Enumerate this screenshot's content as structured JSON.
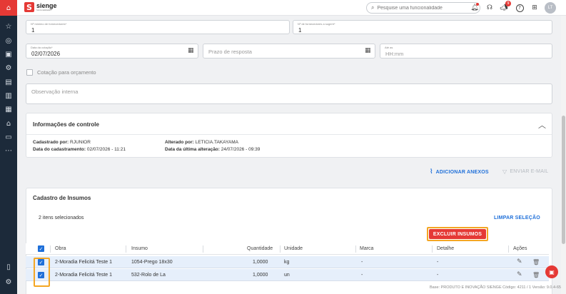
{
  "header": {
    "brand_name": "sienge",
    "brand_sub": "funcionalidades",
    "search_placeholder": "Pesquise uma funcionalidade",
    "notifications_count": "9",
    "avatar_initials": "LT"
  },
  "form": {
    "min_suppliers_label": "Nº mínimo de fornecedores*",
    "min_suppliers_value": "1",
    "suggested_suppliers_label": "Nº de fornecedores a sugerir*",
    "suggested_suppliers_value": "1",
    "quote_date_label": "Data da cotação*",
    "quote_date_value": "02/07/2026",
    "response_deadline_placeholder": "Prazo de resposta",
    "until_label": "Até as",
    "until_placeholder": "HH:mm",
    "budget_quote_label": "Cotação para orçamento",
    "internal_note_placeholder": "Observação interna"
  },
  "control_info": {
    "title": "Informações de controle",
    "registered_by_label": "Cadastrado por:",
    "registered_by_value": "RJUNIOR",
    "registered_date_label": "Data do cadastramento:",
    "registered_date_value": "02/07/2026 - 11:21",
    "changed_by_label": "Alterado por:",
    "changed_by_value": "LETICIA.TAKAYAMA",
    "changed_date_label": "Data da última alteração:",
    "changed_date_value": "24/07/2026 - 09:39"
  },
  "actions": {
    "add_attachments": "ADICIONAR ANEXOS",
    "send_email": "ENVIAR E-MAIL"
  },
  "inputs_section": {
    "title": "Cadastro de Insumos",
    "selected_text": "2 itens selecionados",
    "delete_button": "EXCLUIR INSUMOS",
    "clear_selection": "LIMPAR SELEÇÃO",
    "columns": {
      "obra": "Obra",
      "insumo": "Insumo",
      "quantidade": "Quantidade",
      "unidade": "Unidade",
      "marca": "Marca",
      "detalhe": "Detalhe",
      "acoes": "Ações"
    },
    "rows": [
      {
        "obra": "2-Moradia Felicitá Teste 1",
        "insumo": "1054-Prego 18x30",
        "quantidade": "1,0000",
        "unidade": "kg",
        "marca": "-",
        "detalhe": "-"
      },
      {
        "obra": "2-Moradia Felicitá Teste 1",
        "insumo": "532-Rolo de La",
        "quantidade": "1,0000",
        "unidade": "un",
        "marca": "-",
        "detalhe": "-"
      }
    ]
  },
  "footer": {
    "text": "Base: PRODUTO E INOVAÇÃO SIENGE  Código: 4211 / 1  Versão: 9.0.4-65"
  },
  "colors": {
    "brand_red": "#e53935",
    "rail_bg": "#1c2a3a",
    "primary_blue": "#1e6fd9",
    "highlight_orange": "#f4a623"
  }
}
